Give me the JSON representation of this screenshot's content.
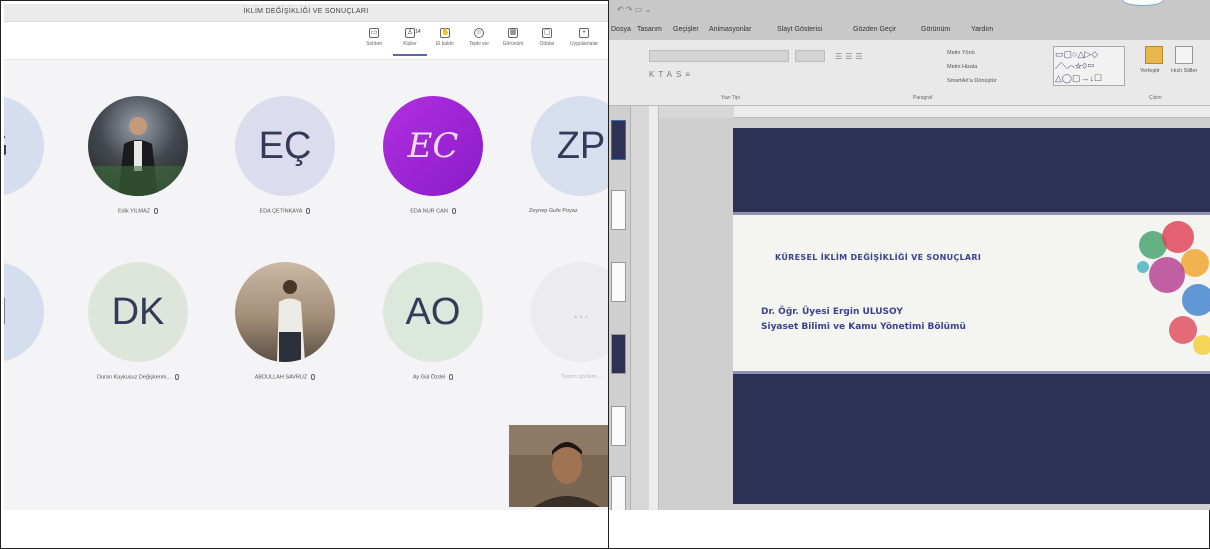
{
  "teams": {
    "meeting_title": "İKLİM DEĞİŞİKLİĞİ VE SONUÇLARI",
    "toolbar": [
      {
        "label": "Sohbet",
        "icon": "chat-icon"
      },
      {
        "label": "Kişiler",
        "icon": "people-icon",
        "count": "14"
      },
      {
        "label": "El kaldır",
        "icon": "raise-hand-icon"
      },
      {
        "label": "Tepki ver",
        "icon": "reaction-icon"
      },
      {
        "label": "Görünüm",
        "icon": "view-icon"
      },
      {
        "label": "Odalar",
        "icon": "rooms-icon"
      },
      {
        "label": "Uygulamalar",
        "icon": "apps-icon"
      }
    ],
    "participants_row1": [
      {
        "initials": "G",
        "name": "",
        "bg": "#d4deee"
      },
      {
        "initials": "",
        "name": "Edik YILMAZ",
        "bg": "#3a3a3a",
        "photo": true
      },
      {
        "initials": "EÇ",
        "name": "EDA ÇETİNKAYA",
        "bg": "#dcdcee"
      },
      {
        "initials": "EC",
        "name": "EDA NUR CAN",
        "bg": "#9b2bd8"
      },
      {
        "initials": "ZP",
        "name": "Zeynep Gufe Poyaz",
        "bg": "#d7dfee"
      }
    ],
    "participants_row2": [
      {
        "initials": "H",
        "name": "",
        "bg": "#d4deee"
      },
      {
        "initials": "DK",
        "name": "Duran Kaykusuz Değişkenm...",
        "bg": "#dee6dc"
      },
      {
        "initials": "",
        "name": "ABDULLAH SAVRUZ",
        "bg": "#5a5550",
        "photo": true
      },
      {
        "initials": "AO",
        "name": "Ay Gül Özdel",
        "bg": "#dde8dc"
      },
      {
        "initials": "...",
        "name": "Teams gözlem...",
        "bg": "#ececef"
      }
    ]
  },
  "ppt": {
    "tabs": [
      "Dosya",
      "Tasarım",
      "Geçişler",
      "Animasyonlar",
      "Slayt Gösterisi",
      "Gözden Geçir",
      "Görünüm",
      "Yardım"
    ],
    "ribbon": {
      "font_group": "Yazı Tipi",
      "paragraph_group": "Paragraf",
      "drawing_group": "Çizim",
      "text_direction": "Metin Yönü",
      "align_text": "Metni Hizala",
      "smartart": "SmartArt'a Dönüştür",
      "arrange": "Yerleştir",
      "quick_styles": "Hızlı Stiller"
    },
    "slide": {
      "title": "KÜRESEL İKLİM DEĞİŞİKLİĞİ VE SONUÇLARI",
      "author": "Dr. Öğr. Üyesi Ergin ULUSOY",
      "department": "Siyaset Bilimi ve Kamu Yönetimi Bölümü"
    }
  },
  "colors": {
    "teams_accent": "#6264a7",
    "slide_background": "#2d3254",
    "slide_text": "#3a4490"
  }
}
